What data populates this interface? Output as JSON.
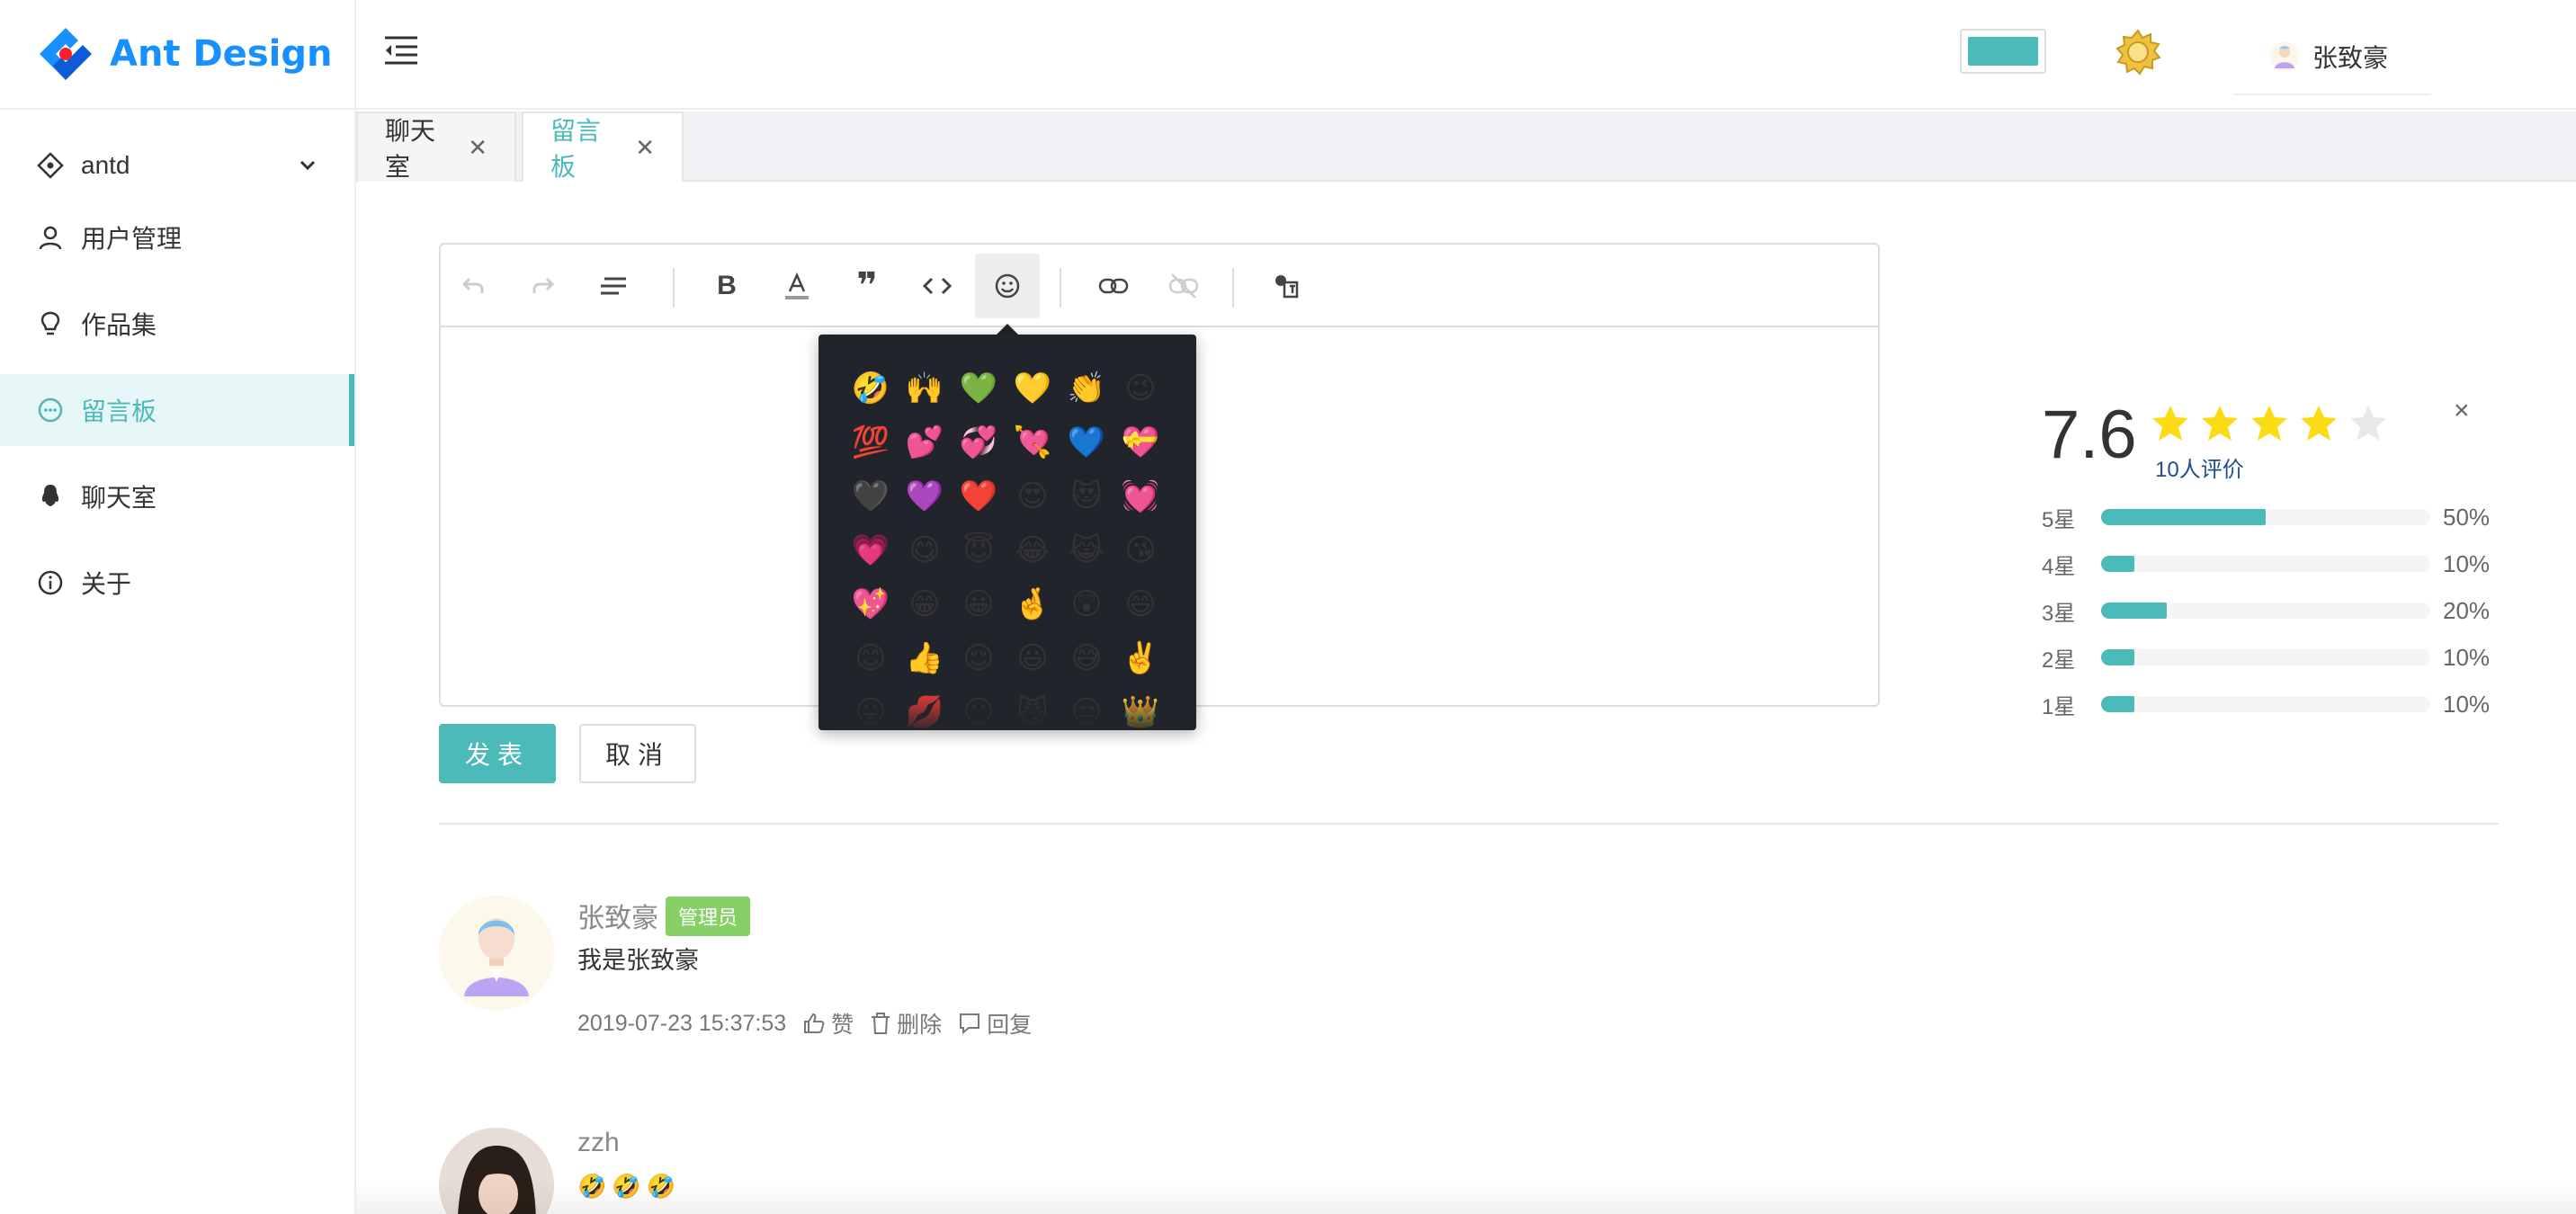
{
  "app": {
    "logo_text": "Ant Design"
  },
  "sidebar": {
    "items": [
      {
        "label": "antd",
        "icon": "antd-icon",
        "expandable": true
      },
      {
        "label": "用户管理",
        "icon": "user-icon"
      },
      {
        "label": "作品集",
        "icon": "bulb-icon"
      },
      {
        "label": "留言板",
        "icon": "message-icon",
        "active": true
      },
      {
        "label": "聊天室",
        "icon": "qq-icon"
      },
      {
        "label": "关于",
        "icon": "info-icon"
      }
    ]
  },
  "header": {
    "user_name": "张致豪",
    "theme_color": "#4cbab9"
  },
  "tabs": [
    {
      "label": "聊天室",
      "active": false
    },
    {
      "label": "留言板",
      "active": true
    }
  ],
  "editor": {
    "toolbar": [
      "undo",
      "redo",
      "align",
      "bold",
      "font-color",
      "blockquote",
      "code",
      "emoji",
      "link",
      "unlink",
      "media"
    ],
    "emojis": [
      "🤣",
      "🙌",
      "💚",
      "💛",
      "👏",
      "😉",
      "💯",
      "💕",
      "💞",
      "💘",
      "💙",
      "💝",
      "🖤",
      "💜",
      "❤️",
      "😍",
      "😻",
      "💓",
      "💗",
      "😋",
      "😇",
      "😂",
      "😹",
      "😘",
      "💖",
      "😁",
      "😀",
      "🤞",
      "😲",
      "😄",
      "😊",
      "👍",
      "😌",
      "😃",
      "😅",
      "✌️",
      "😛",
      "💋",
      "😶",
      "😼",
      "😒",
      "👑"
    ]
  },
  "buttons": {
    "submit": "发表",
    "cancel": "取消"
  },
  "rating": {
    "score": "7.6",
    "stars": 4,
    "count_label": "10人评价",
    "close": "×",
    "rows": [
      {
        "label": "5星",
        "percent": 50,
        "pct_label": "50%"
      },
      {
        "label": "4星",
        "percent": 10,
        "pct_label": "10%"
      },
      {
        "label": "3星",
        "percent": 20,
        "pct_label": "20%"
      },
      {
        "label": "2星",
        "percent": 10,
        "pct_label": "10%"
      },
      {
        "label": "1星",
        "percent": 10,
        "pct_label": "10%"
      }
    ]
  },
  "comments": [
    {
      "author": "张致豪",
      "badge": "管理员",
      "text": "我是张致豪",
      "time": "2019-07-23 15:37:53",
      "like": "赞",
      "delete": "删除",
      "reply": "回复"
    },
    {
      "author": "zzh",
      "text": "🤣🤣🤣"
    }
  ],
  "colors": {
    "accent": "#4cbab9",
    "badge": "#87d068",
    "star": "#fadb14"
  }
}
